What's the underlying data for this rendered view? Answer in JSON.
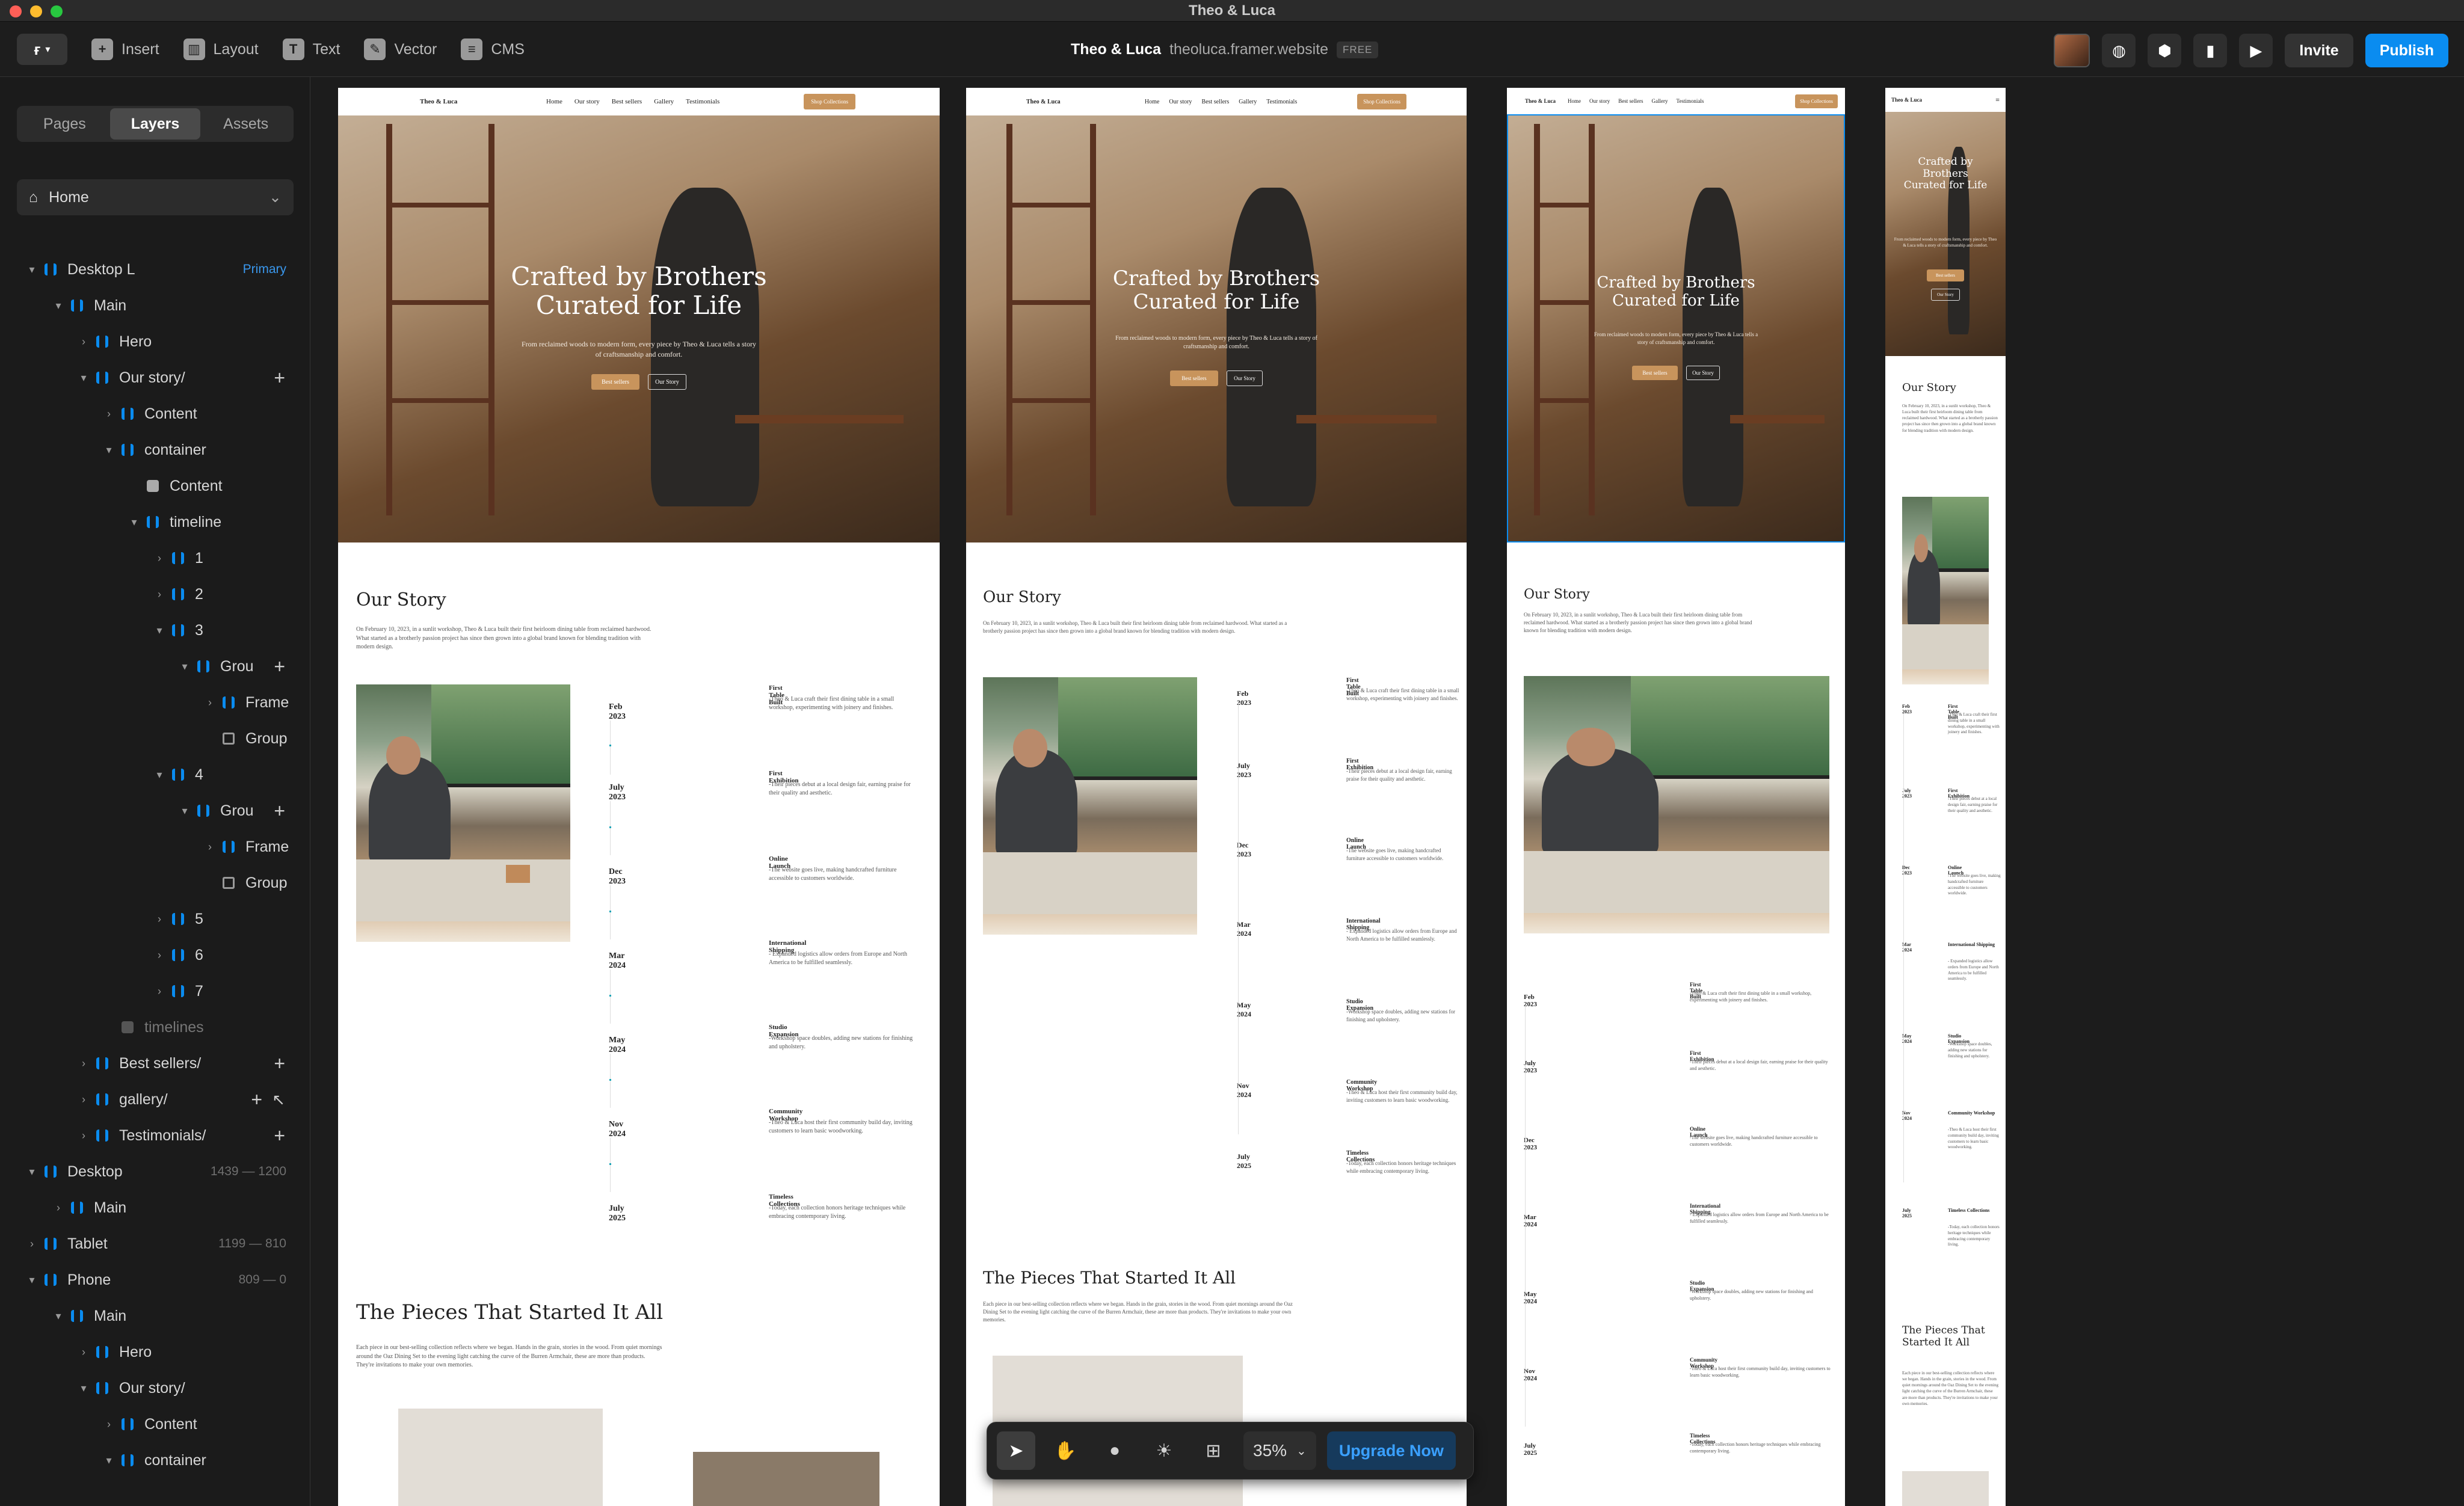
{
  "window": {
    "title": "Theo & Luca"
  },
  "toolbar": {
    "insert": "Insert",
    "layout": "Layout",
    "text": "Text",
    "vector": "Vector",
    "cms": "CMS",
    "project": "Theo & Luca",
    "url": "theoluca.framer.website",
    "plan": "FREE",
    "invite": "Invite",
    "publish": "Publish"
  },
  "sidebar": {
    "tabs": [
      "Pages",
      "Layers",
      "Assets"
    ],
    "active_tab": "Layers",
    "page": "Home",
    "layers": [
      {
        "label": "Desktop L",
        "meta": "Primary"
      },
      {
        "label": "Main"
      },
      {
        "label": "Hero"
      },
      {
        "label": "Our story/"
      },
      {
        "label": "Content"
      },
      {
        "label": "container"
      },
      {
        "label": "Content"
      },
      {
        "label": "timeline"
      },
      {
        "label": "1"
      },
      {
        "label": "2"
      },
      {
        "label": "3"
      },
      {
        "label": "Grou"
      },
      {
        "label": "Frame"
      },
      {
        "label": "Group"
      },
      {
        "label": "4"
      },
      {
        "label": "Grou"
      },
      {
        "label": "Frame"
      },
      {
        "label": "Group"
      },
      {
        "label": "5"
      },
      {
        "label": "6"
      },
      {
        "label": "7"
      },
      {
        "label": "timelines"
      },
      {
        "label": "Best sellers/"
      },
      {
        "label": "gallery/"
      },
      {
        "label": "Testimonials/"
      },
      {
        "label": "Desktop",
        "meta": "1439 — 1200"
      },
      {
        "label": "Main"
      },
      {
        "label": "Tablet",
        "meta": "1199 — 810"
      },
      {
        "label": "Phone",
        "meta": "809 — 0"
      },
      {
        "label": "Main"
      },
      {
        "label": "Hero"
      },
      {
        "label": "Our story/"
      },
      {
        "label": "Content"
      },
      {
        "label": "container"
      }
    ]
  },
  "site": {
    "brand": "Theo & Luca",
    "nav": [
      "Home",
      "Our story",
      "Best sellers",
      "Gallery",
      "Testimonials"
    ],
    "nav_cta": "Shop Collections",
    "hero_title_1": "Crafted by Brothers",
    "hero_title_2": "Curated for Life",
    "hero_sub": "From reclaimed woods to modern form, every piece by Theo & Luca tells a story of craftsmanship and comfort.",
    "btn_primary": "Best sellers",
    "btn_secondary": "Our Story",
    "story_title": "Our Story",
    "story_body": "On February 10, 2023, in a sunlit workshop, Theo & Luca built their first heirloom dining table from reclaimed hardwood. What started as a brotherly passion project has since then grown into a global brand known for blending tradition with modern design.",
    "timeline": [
      {
        "date": "Feb 2023",
        "title": "First Table Built",
        "text": "-Theo & Luca craft their first dining table in a small workshop, experimenting with joinery and finishes."
      },
      {
        "date": "July 2023",
        "title": "First Exhibition",
        "text": "-Their pieces debut at a local design fair, earning praise for their quality and aesthetic."
      },
      {
        "date": "Dec 2023",
        "title": "Online Launch",
        "text": "-The website goes live, making handcrafted furniture accessible to customers worldwide."
      },
      {
        "date": "Mar 2024",
        "title": "International Shipping",
        "text": "- Expanded logistics allow orders from Europe and North America to be fulfilled seamlessly."
      },
      {
        "date": "May 2024",
        "title": "Studio Expansion",
        "text": "-Workshop space doubles, adding new stations for finishing and upholstery."
      },
      {
        "date": "Nov 2024",
        "title": "Community Workshop",
        "text": "-Theo & Luca host their first community build day, inviting customers to learn basic woodworking."
      },
      {
        "date": "July 2025",
        "title": "Timeless Collections",
        "text": "-Today, each collection honors heritage techniques while embracing contemporary living."
      }
    ],
    "pieces_title": "The Pieces That Started It All",
    "pieces_title_a": "The Pieces That",
    "pieces_title_b": "Started It All",
    "pieces_body": "Each piece in our best-selling collection reflects where we began. Hands in the grain, stories in the wood. From quiet mornings around the Oaz Dining Set to the evening light catching the curve of the Burren Armchair, these are more than products. They're invitations to make your own memories."
  },
  "floatbar": {
    "zoom": "35%",
    "upgrade": "Upgrade Now"
  },
  "colors": {
    "accent": "#0a8cf0",
    "brand": "#c8945c",
    "timeline_dot": "#1aa5b8"
  }
}
